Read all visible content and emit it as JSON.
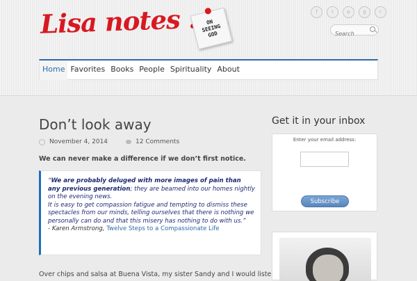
{
  "header": {
    "logo": "Lisa notes . . .",
    "note_lines": [
      "ON",
      "SEEING",
      "GOD"
    ],
    "social_icons": [
      "facebook-icon",
      "twitter-icon",
      "pinterest-icon",
      "google-plus-icon",
      "rss-icon"
    ],
    "search_placeholder": "Search"
  },
  "nav": {
    "items": [
      "Home",
      "Favorites",
      "Books",
      "People",
      "Spirituality",
      "About"
    ],
    "active": "Home"
  },
  "post": {
    "title": "Don’t look away",
    "date": "November 4, 2014",
    "comments": "12 Comments",
    "lead": "We can never make a difference if we don’t first notice.",
    "quote_open": "“",
    "quote_bold": "We are probably deluged with more images of pain than any previous generation",
    "quote_rest1": "; they are beamed into our homes nightly on the evening news.",
    "quote_rest2": "It is easy to get compassion fatigue and tempting to dismiss these spectacles from our minds, telling ourselves that there is nothing we personally can do and that this misery has nothing to do with us.”",
    "attribution": "- Karen Armstrong,",
    "book_link": "Twelve Steps to a Compassionate Life",
    "body_start": "Over chips and salsa at Buena Vista, my sister Sandy and I would listen"
  },
  "sidebar": {
    "title": "Get it in your inbox",
    "email_label": "Enter your email address:",
    "subscribe": "Subscribe"
  },
  "colors": {
    "accent": "#2c6aa8",
    "logo": "#d71921",
    "quote_text": "#1c2a72"
  }
}
